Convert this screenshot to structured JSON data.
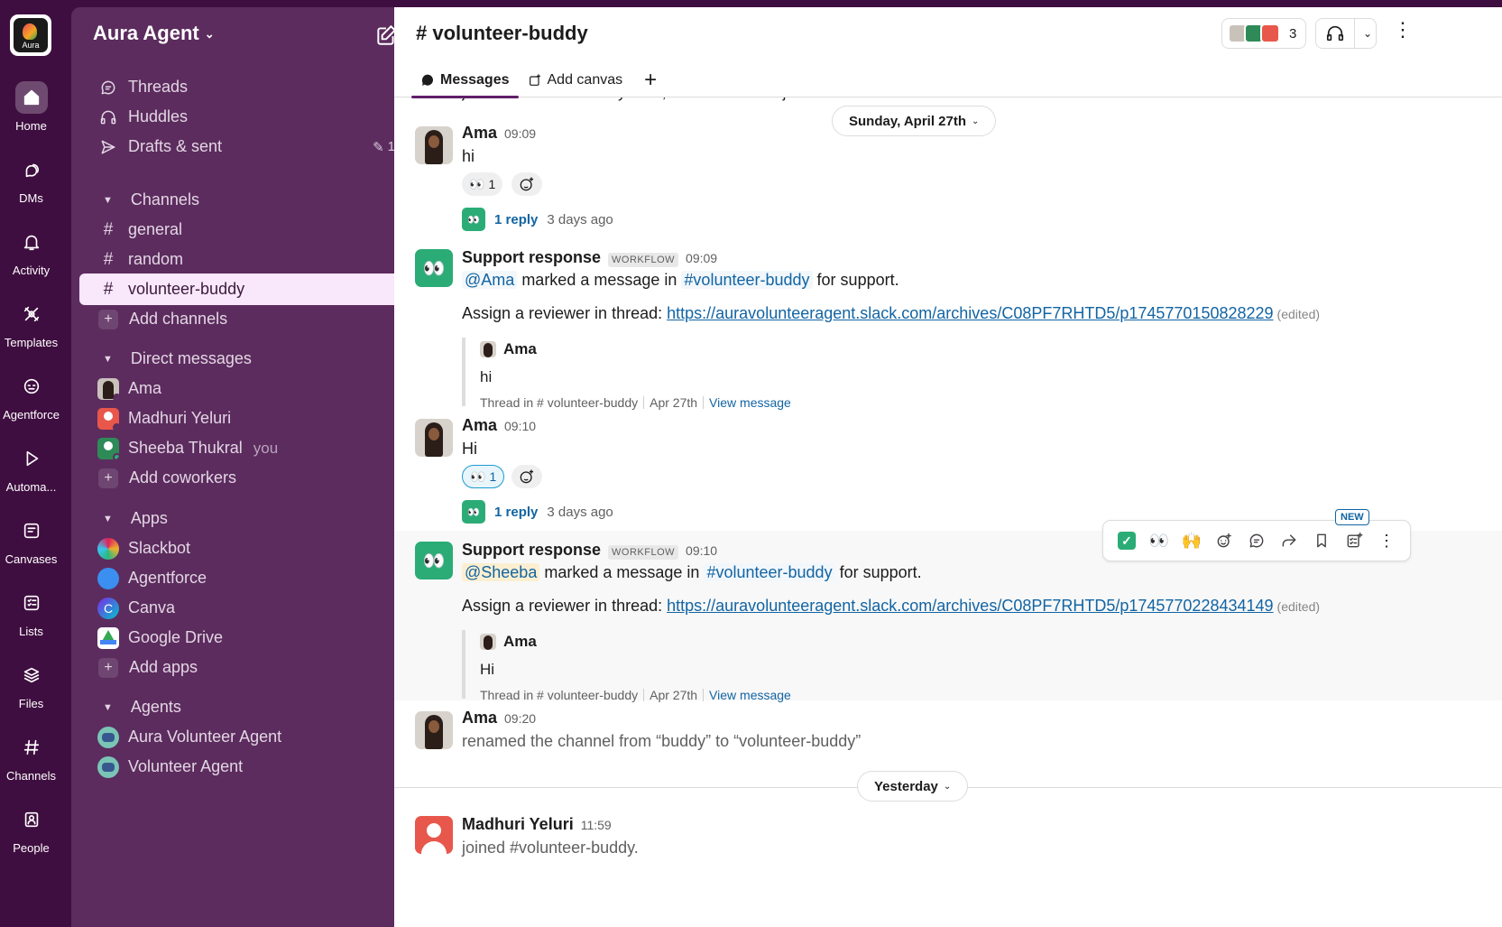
{
  "rail": {
    "logo_text": "Aura",
    "items": [
      {
        "label": "Home",
        "icon": "home-icon"
      },
      {
        "label": "DMs",
        "icon": "dms-icon"
      },
      {
        "label": "Activity",
        "icon": "bell-icon"
      },
      {
        "label": "Templates",
        "icon": "templates-icon"
      },
      {
        "label": "Agentforce",
        "icon": "agentforce-icon"
      },
      {
        "label": "Automa...",
        "icon": "play-icon"
      },
      {
        "label": "Canvases",
        "icon": "canvas-icon"
      },
      {
        "label": "Lists",
        "icon": "lists-icon"
      },
      {
        "label": "Files",
        "icon": "files-icon"
      },
      {
        "label": "Channels",
        "icon": "hash-icon"
      },
      {
        "label": "People",
        "icon": "people-icon"
      }
    ]
  },
  "sidebar": {
    "workspace": "Aura Agent",
    "top": [
      {
        "label": "Threads"
      },
      {
        "label": "Huddles"
      },
      {
        "label": "Drafts & sent",
        "count": "1"
      }
    ],
    "channels_header": "Channels",
    "channels": [
      "general",
      "random",
      "volunteer-buddy"
    ],
    "add_channels": "Add channels",
    "dm_header": "Direct messages",
    "dms": [
      {
        "name": "Ama"
      },
      {
        "name": "Madhuri Yeluri"
      },
      {
        "name": "Sheeba Thukral",
        "suffix": "you"
      }
    ],
    "add_coworkers": "Add coworkers",
    "apps_header": "Apps",
    "apps": [
      "Slackbot",
      "Agentforce",
      "Canva",
      "Google Drive"
    ],
    "canva_letter": "C",
    "add_apps": "Add apps",
    "agents_header": "Agents",
    "agents": [
      "Aura Volunteer Agent",
      "Volunteer Agent"
    ]
  },
  "header": {
    "title": "# volunteer-buddy",
    "member_count": "3",
    "tabs": [
      {
        "label": "Messages"
      },
      {
        "label": "Add canvas"
      }
    ],
    "add_tab": "+"
  },
  "messages": {
    "cut_line": "joined #volunteer-buddy. Also, Sheeba Thukral joined.",
    "date1": "Sunday, April 27th",
    "date2": "Yesterday",
    "m1": {
      "name": "Ama",
      "time": "09:09",
      "text": "hi",
      "reaction_emoji": "👀",
      "reaction_count": "1",
      "reply": "1 reply",
      "ago": "3 days ago"
    },
    "m2": {
      "name": "Support response",
      "tag": "WORKFLOW",
      "time": "09:09",
      "mention": "@Ama",
      "mid": "marked a message in",
      "channel": "#volunteer-buddy",
      "end": "for support.",
      "assign": "Assign a reviewer in thread:",
      "url": "https://auravolunteeragent.slack.com/archives/C08PF7RHTD5/p1745770150828229",
      "edited": "(edited)",
      "q_name": "Ama",
      "q_text": "hi",
      "q_thread": "Thread in # volunteer-buddy",
      "q_date": "Apr 27th",
      "q_view": "View message"
    },
    "m3": {
      "name": "Ama",
      "time": "09:10",
      "text": "Hi",
      "reaction_emoji": "👀",
      "reaction_count": "1",
      "reply": "1 reply",
      "ago": "3 days ago"
    },
    "m4": {
      "name": "Support response",
      "tag": "WORKFLOW",
      "time": "09:10",
      "mention": "@Sheeba",
      "mid": "marked a message in",
      "channel": "#volunteer-buddy",
      "end": "for support.",
      "assign": "Assign a reviewer in thread:",
      "url": "https://auravolunteeragent.slack.com/archives/C08PF7RHTD5/p1745770228434149",
      "edited": "(edited)",
      "q_name": "Ama",
      "q_text": "Hi",
      "q_thread": "Thread in # volunteer-buddy",
      "q_date": "Apr 27th",
      "q_view": "View message"
    },
    "m5": {
      "name": "Ama",
      "time": "09:20",
      "text": "renamed the channel from “buddy” to “volunteer-buddy”"
    },
    "m6": {
      "name": "Madhuri Yeluri",
      "time": "11:59",
      "text": "joined #volunteer-buddy."
    }
  },
  "toolbar": {
    "check": "✓",
    "eyes": "👀",
    "raised_hands": "🙌",
    "new_badge": "NEW",
    "more": "⋮"
  },
  "colors": {
    "rail_bg": "#3f0e40",
    "sidebar_bg": "#5c2c5e",
    "active_row": "#f9e7fb",
    "link": "#1264a3",
    "workflow_green": "#2bac76"
  }
}
